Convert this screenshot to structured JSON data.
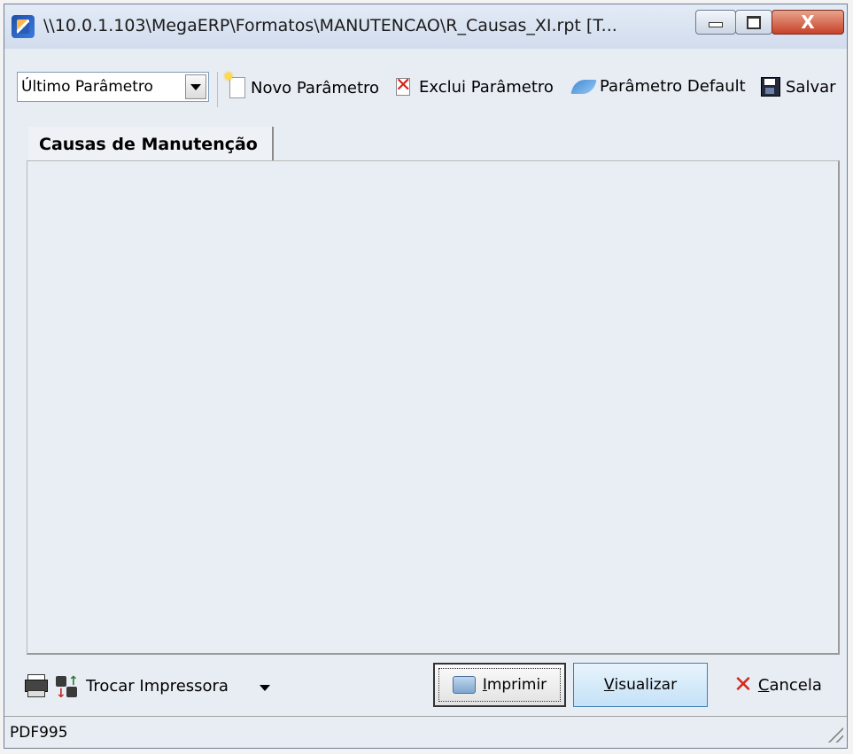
{
  "window": {
    "title": "\\\\10.0.1.103\\MegaERP\\Formatos\\MANUTENCAO\\R_Causas_XI.rpt [T...",
    "close_glyph": "X"
  },
  "toolbar": {
    "parameter_select": {
      "selected": "Último Parâmetro"
    },
    "new_parameter": "Novo Parâmetro",
    "delete_parameter": "Exclui Parâmetro",
    "default_parameter": "Parâmetro Default",
    "save": "Salvar"
  },
  "tabs": [
    {
      "label": "Causas de Manutenção",
      "active": true
    }
  ],
  "bottom": {
    "change_printer": "Trocar Impressora",
    "print": {
      "accel": "I",
      "rest": "mprimir"
    },
    "preview": {
      "accel": "V",
      "rest": "isualizar"
    },
    "cancel": {
      "accel": "C",
      "rest": "ancela"
    }
  },
  "status": {
    "printer": "PDF995"
  },
  "colors": {
    "window_bg": "#e8edf4",
    "preview_button_bg": "#c4e1f7",
    "cancel_icon": "#d42a1c"
  },
  "icons": [
    "app-icon",
    "new-document-icon",
    "delete-icon",
    "default-parameter-icon",
    "save-icon",
    "printer-icon",
    "swap-printer-icon",
    "print-icon",
    "cancel-icon",
    "resize-grip-icon"
  ]
}
